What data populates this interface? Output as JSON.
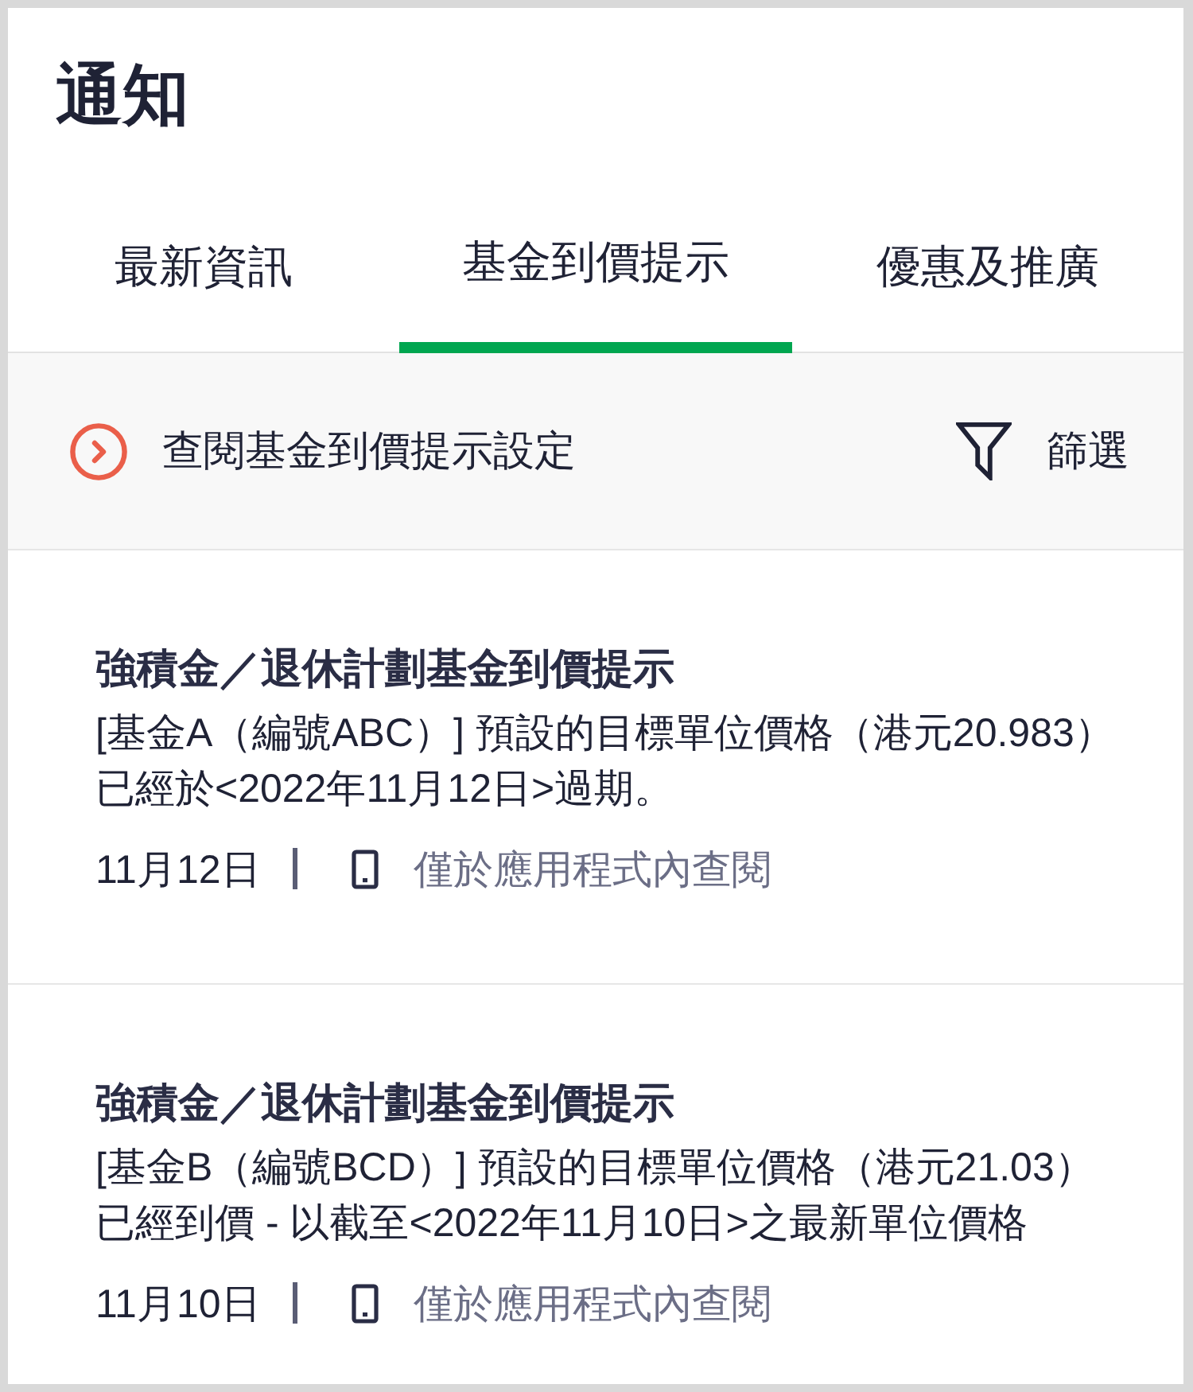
{
  "header": {
    "title": "通知"
  },
  "tabs": [
    {
      "label": "最新資訊",
      "selected": false
    },
    {
      "label": "基金到價提示",
      "selected": true
    },
    {
      "label": "優惠及推廣",
      "selected": false
    }
  ],
  "toolbar": {
    "settings_link": "查閱基金到價提示設定",
    "filter_button": "篩選"
  },
  "notifications": [
    {
      "title": "強積金／退休計劃基金到價提示",
      "body": "[基金A（編號ABC）] 預設的目標單位價格（港元20.983）已經於<2022年11月12日>過期。",
      "date": "11月12日",
      "channel": "僅於應用程式內查閱"
    },
    {
      "title": "強積金／退休計劃基金到價提示",
      "body": "[基金B（編號BCD）] 預設的目標單位價格（港元21.03）已經到價 - 以截至<2022年11月10日>之最新單位價格",
      "date": "11月10日",
      "channel": "僅於應用程式內查閱"
    }
  ]
}
